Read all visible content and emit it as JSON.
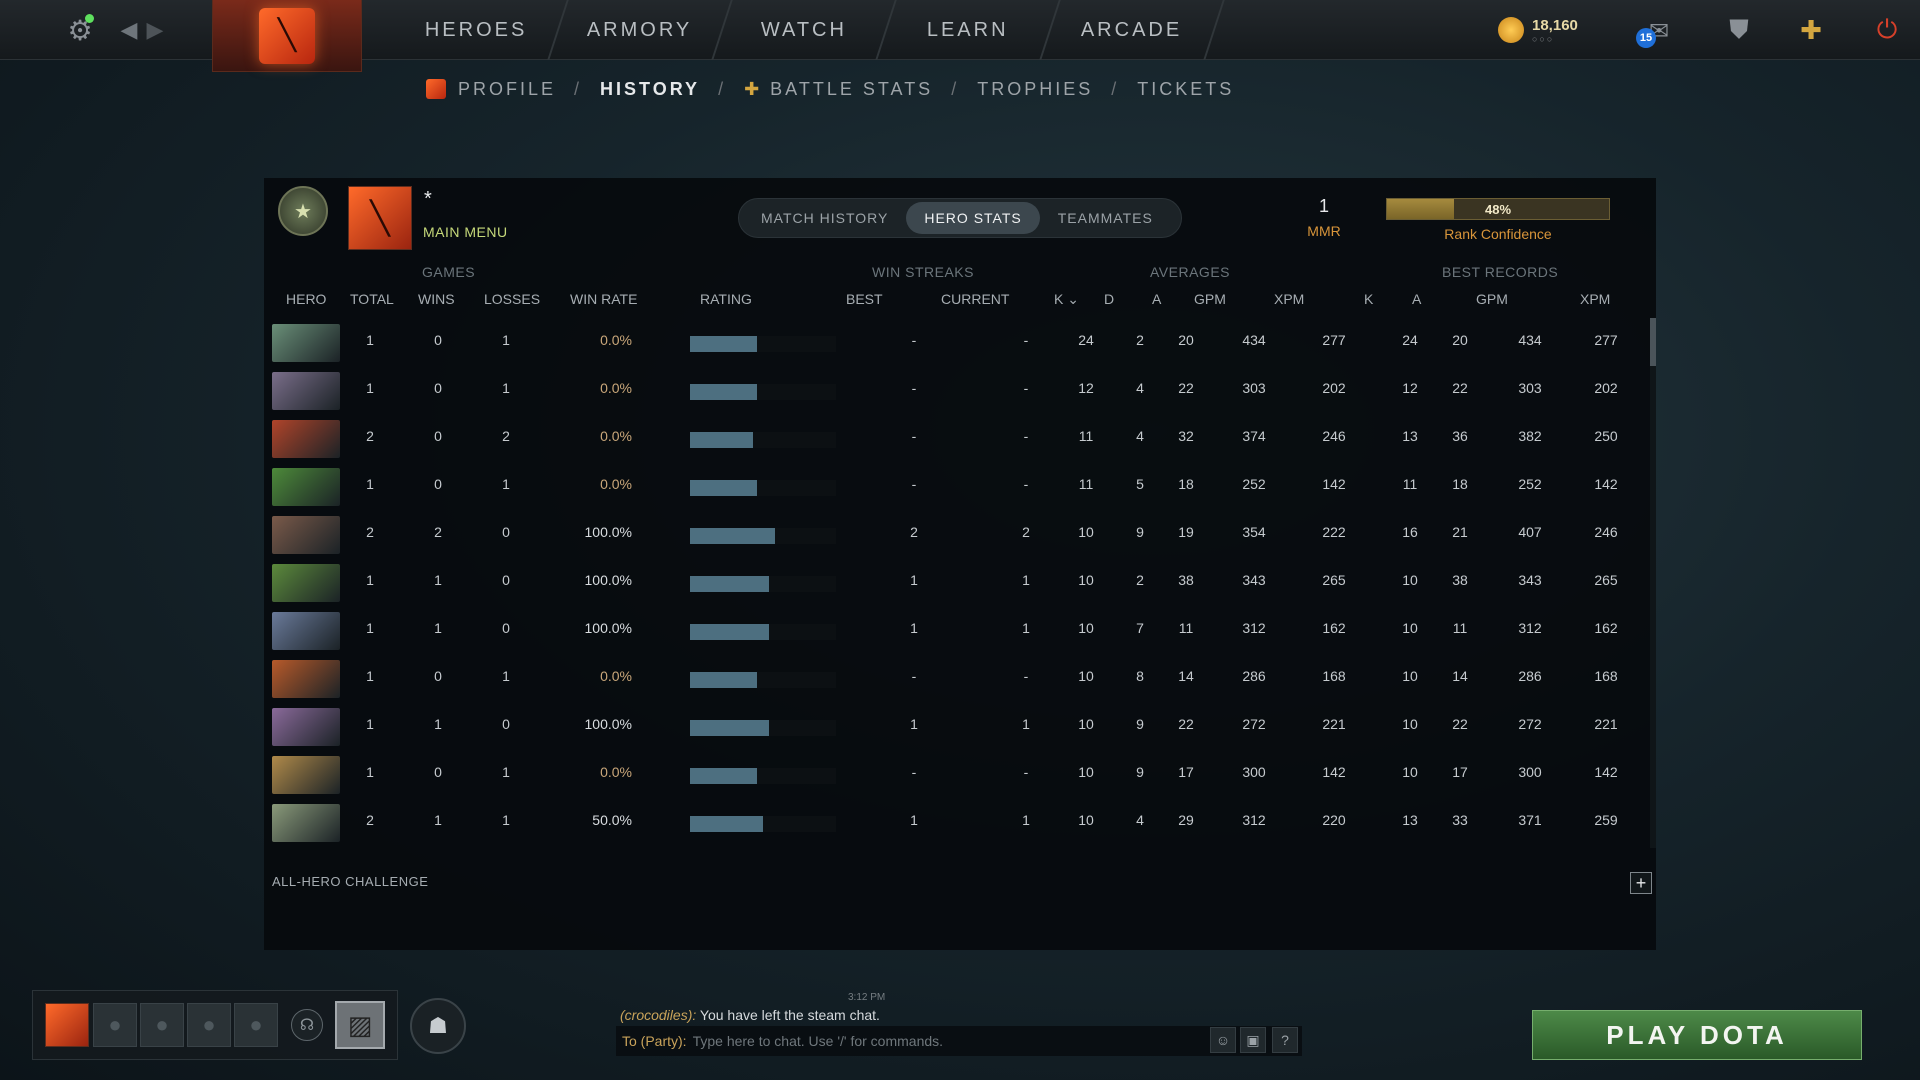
{
  "top_nav": {
    "items": [
      "HEROES",
      "ARMORY",
      "WATCH",
      "LEARN",
      "ARCADE"
    ],
    "currency_amount": "18,160",
    "currency_sub": "○○○",
    "mail_count": "15"
  },
  "sub_nav": {
    "profile": "PROFILE",
    "history": "HISTORY",
    "battle_stats": "BATTLE STATS",
    "trophies": "TROPHIES",
    "tickets": "TICKETS",
    "separator": "/"
  },
  "player": {
    "name": "*",
    "main_menu": "MAIN MENU"
  },
  "tabs": [
    "MATCH HISTORY",
    "HERO STATS",
    "TEAMMATES"
  ],
  "active_tab": "HERO STATS",
  "mmr": {
    "value": "1",
    "label": "MMR"
  },
  "rank_confidence": {
    "percent_label": "48%",
    "fraction": 0.3,
    "label": "Rank Confidence"
  },
  "group_headers": {
    "games": "GAMES",
    "win_streaks": "WIN STREAKS",
    "averages": "AVERAGES",
    "best_records": "BEST RECORDS"
  },
  "columns": {
    "hero": "HERO",
    "total": "TOTAL",
    "wins": "WINS",
    "losses": "LOSSES",
    "win_rate": "WIN RATE",
    "rating": "RATING",
    "best": "BEST",
    "current": "CURRENT",
    "avg_k": "K",
    "avg_d": "D",
    "avg_a": "A",
    "avg_gpm": "GPM",
    "avg_xpm": "XPM",
    "best_k": "K",
    "best_a": "A",
    "best_gpm": "GPM",
    "best_xpm": "XPM"
  },
  "heroes": [
    {
      "color": "#6a8f78",
      "total": "1",
      "wins": "0",
      "losses": "1",
      "win_rate": "0.0%",
      "rating": 0.46,
      "best": "-",
      "current": "-",
      "k": "24",
      "d": "2",
      "a": "20",
      "gpm": "434",
      "xpm": "277",
      "bk": "24",
      "ba": "20",
      "bgpm": "434",
      "bxpm": "277"
    },
    {
      "color": "#7a6e8a",
      "total": "1",
      "wins": "0",
      "losses": "1",
      "win_rate": "0.0%",
      "rating": 0.46,
      "best": "-",
      "current": "-",
      "k": "12",
      "d": "4",
      "a": "22",
      "gpm": "303",
      "xpm": "202",
      "bk": "12",
      "ba": "22",
      "bgpm": "303",
      "bxpm": "202"
    },
    {
      "color": "#b0442a",
      "total": "2",
      "wins": "0",
      "losses": "2",
      "win_rate": "0.0%",
      "rating": 0.43,
      "best": "-",
      "current": "-",
      "k": "11",
      "d": "4",
      "a": "32",
      "gpm": "374",
      "xpm": "246",
      "bk": "13",
      "ba": "36",
      "bgpm": "382",
      "bxpm": "250"
    },
    {
      "color": "#4d8a3a",
      "total": "1",
      "wins": "0",
      "losses": "1",
      "win_rate": "0.0%",
      "rating": 0.46,
      "best": "-",
      "current": "-",
      "k": "11",
      "d": "5",
      "a": "18",
      "gpm": "252",
      "xpm": "142",
      "bk": "11",
      "ba": "18",
      "bgpm": "252",
      "bxpm": "142"
    },
    {
      "color": "#7a5a4a",
      "total": "2",
      "wins": "2",
      "losses": "0",
      "win_rate": "100.0%",
      "rating": 0.58,
      "best": "2",
      "current": "2",
      "k": "10",
      "d": "9",
      "a": "19",
      "gpm": "354",
      "xpm": "222",
      "bk": "16",
      "ba": "21",
      "bgpm": "407",
      "bxpm": "246"
    },
    {
      "color": "#5c8a3c",
      "total": "1",
      "wins": "1",
      "losses": "0",
      "win_rate": "100.0%",
      "rating": 0.54,
      "best": "1",
      "current": "1",
      "k": "10",
      "d": "2",
      "a": "38",
      "gpm": "343",
      "xpm": "265",
      "bk": "10",
      "ba": "38",
      "bgpm": "343",
      "bxpm": "265"
    },
    {
      "color": "#6a7a9a",
      "total": "1",
      "wins": "1",
      "losses": "0",
      "win_rate": "100.0%",
      "rating": 0.54,
      "best": "1",
      "current": "1",
      "k": "10",
      "d": "7",
      "a": "11",
      "gpm": "312",
      "xpm": "162",
      "bk": "10",
      "ba": "11",
      "bgpm": "312",
      "bxpm": "162"
    },
    {
      "color": "#b85a2a",
      "total": "1",
      "wins": "0",
      "losses": "1",
      "win_rate": "0.0%",
      "rating": 0.46,
      "best": "-",
      "current": "-",
      "k": "10",
      "d": "8",
      "a": "14",
      "gpm": "286",
      "xpm": "168",
      "bk": "10",
      "ba": "14",
      "bgpm": "286",
      "bxpm": "168"
    },
    {
      "color": "#8a6a9a",
      "total": "1",
      "wins": "1",
      "losses": "0",
      "win_rate": "100.0%",
      "rating": 0.54,
      "best": "1",
      "current": "1",
      "k": "10",
      "d": "9",
      "a": "22",
      "gpm": "272",
      "xpm": "221",
      "bk": "10",
      "ba": "22",
      "bgpm": "272",
      "bxpm": "221"
    },
    {
      "color": "#b08a4a",
      "total": "1",
      "wins": "0",
      "losses": "1",
      "win_rate": "0.0%",
      "rating": 0.46,
      "best": "-",
      "current": "-",
      "k": "10",
      "d": "9",
      "a": "17",
      "gpm": "300",
      "xpm": "142",
      "bk": "10",
      "ba": "17",
      "bgpm": "300",
      "bxpm": "142"
    },
    {
      "color": "#8a9a7a",
      "total": "2",
      "wins": "1",
      "losses": "1",
      "win_rate": "50.0%",
      "rating": 0.5,
      "best": "1",
      "current": "1",
      "k": "10",
      "d": "4",
      "a": "29",
      "gpm": "312",
      "xpm": "220",
      "bk": "13",
      "ba": "33",
      "bgpm": "371",
      "bxpm": "259"
    }
  ],
  "all_hero_challenge": "ALL-HERO CHALLENGE",
  "chat": {
    "time": "3:12 PM",
    "sender": "(crocodiles):",
    "message": "You have left the steam chat.",
    "channel": "To (Party):",
    "placeholder": "Type here to chat. Use '/' for commands."
  },
  "play_button": "PLAY DOTA"
}
